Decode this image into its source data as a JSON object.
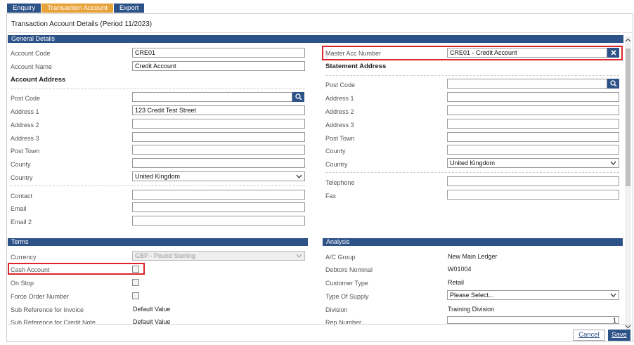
{
  "tabs": [
    "Enquiry",
    "Transaction Account",
    "Export"
  ],
  "panel_title": "Transaction Account Details (Period 11/2023)",
  "sections": {
    "general": "General Details",
    "terms": "Terms",
    "analysis": "Analysis"
  },
  "general": {
    "account_code_label": "Account Code",
    "account_code": "CRE01",
    "account_name_label": "Account Name",
    "account_name": "Credit Account",
    "master_acc_label": "Master Acc Number",
    "master_acc": "CRE01 - Credit Account"
  },
  "account_address": {
    "heading": "Account Address",
    "post_code_label": "Post Code",
    "post_code": "",
    "address1_label": "Address 1",
    "address1": "123 Credit Test Street",
    "address2_label": "Address 2",
    "address2": "",
    "address3_label": "Address 3",
    "address3": "",
    "post_town_label": "Post Town",
    "post_town": "",
    "county_label": "County",
    "county": "",
    "country_label": "Country",
    "country": "United Kingdom",
    "contact_label": "Contact",
    "contact": "",
    "email_label": "Email",
    "email": "",
    "email2_label": "Email 2",
    "email2": ""
  },
  "statement_address": {
    "heading": "Statement Address",
    "post_code_label": "Post Code",
    "post_code": "",
    "address1_label": "Address 1",
    "address1": "",
    "address2_label": "Address 2",
    "address2": "",
    "address3_label": "Address 3",
    "address3": "",
    "post_town_label": "Post Town",
    "post_town": "",
    "county_label": "County",
    "county": "",
    "country_label": "Country",
    "country": "United Kingdom",
    "telephone_label": "Telephone",
    "telephone": "",
    "fax_label": "Fax",
    "fax": ""
  },
  "terms": {
    "currency_label": "Currency",
    "currency": "GBP - Pound Sterling",
    "cash_account_label": "Cash Account",
    "on_stop_label": "On Stop",
    "force_order_label": "Force Order Number",
    "sub_ref_invoice_label": "Sub Reference for Invoice",
    "sub_ref_invoice": "Default Value",
    "sub_ref_credit_label": "Sub Reference for Credit Note",
    "sub_ref_credit": "Default Value"
  },
  "analysis": {
    "ac_group_label": "A/C Group",
    "ac_group": "New Main Ledger",
    "debtors_nominal_label": "Debtors Nominal",
    "debtors_nominal": "W01004",
    "customer_type_label": "Customer Type",
    "customer_type": "Retail",
    "type_of_supply_label": "Type Of Supply",
    "type_of_supply": "Please Select...",
    "division_label": "Division",
    "division": "Training Division",
    "rep_number_label": "Rep Number",
    "rep_number": "1"
  },
  "buttons": {
    "cancel": "Cancel",
    "save": "Save"
  },
  "colors": {
    "accent": "#2d5287",
    "active_tab": "#e8a23a",
    "highlight": "#d9252b"
  },
  "icons": [
    "search-icon",
    "close-icon",
    "chevron-down-icon",
    "scroll-up-icon",
    "scroll-down-icon"
  ]
}
